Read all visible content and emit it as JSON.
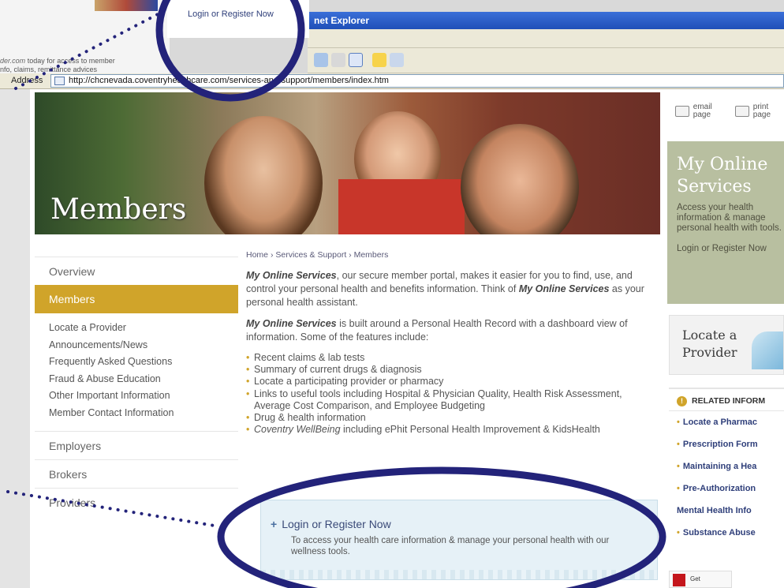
{
  "prev_fragment": {
    "text_line1_link": "der.com",
    "text_line1_rest": " today for access to member",
    "text_line2": "nfo, claims, remittance advices"
  },
  "popup": {
    "login_label": "Login or Register Now"
  },
  "browser": {
    "title": "net Explorer",
    "address_label": "Address",
    "url": "http://chcnevada.coventryhealthcare.com/services-and-support/members/index.htm"
  },
  "hero": {
    "title": "Members"
  },
  "leftnav": {
    "overview": "Overview",
    "members": "Members",
    "sub": [
      "Locate a Provider",
      "Announcements/News",
      "Frequently Asked Questions",
      "Fraud & Abuse Education",
      "Other Important Information",
      "Member Contact Information"
    ],
    "employers": "Employers",
    "brokers": "Brokers",
    "providers": "Providers"
  },
  "breadcrumb": {
    "home": "Home",
    "sep": "›",
    "services": "Services & Support",
    "current": "Members"
  },
  "main": {
    "p1_strong": "My Online Services",
    "p1_a": ", our secure member portal, makes it easier for you to find, use, and control your personal health and benefits information. Think of ",
    "p1_strong2": "My Online Services",
    "p1_b": " as your personal health assistant.",
    "p2_strong": "My Online Services",
    "p2_rest": " is built around a Personal Health Record with a dashboard view of information.  Some of the features include:",
    "bullets": [
      "Recent claims & lab tests",
      "Summary of current drugs & diagnosis",
      "Locate a participating provider or pharmacy",
      "Links to useful tools including Hospital & Physician Quality, Health Risk Assessment, Average Cost Comparison, and Employee Budgeting",
      "Drug & health information"
    ],
    "bullet_last_em": "Coventry WellBeing",
    "bullet_last_rest": " including ePhit Personal Health Improvement & KidsHealth"
  },
  "login_box": {
    "title": "Login or Register Now",
    "desc": "To access your health care information & manage your personal health with our wellness tools."
  },
  "right": {
    "email": "email",
    "email2": "page",
    "print": "print",
    "print2": "page",
    "mos_title1": "My Online",
    "mos_title2": "Services",
    "mos_desc": "Access your health information & manage personal health with tools.",
    "mos_link": "Login or Register Now",
    "locate_title1": "Locate a",
    "locate_title2": "Provider",
    "related_head": "RELATED INFORM",
    "related_items": [
      "Locate a Pharmac",
      "Prescription Form",
      "Maintaining a Hea",
      "Pre-Authorization",
      "Mental Health Info",
      "Substance Abuse"
    ],
    "adobe_get": "Get"
  },
  "colors": {
    "accent_gold": "#d0a42a",
    "annotation_navy": "#23237a",
    "link_navy": "#2f3f7a",
    "sidebar_box": "#b8bfa0",
    "login_box_bg": "#e6f1f7"
  }
}
